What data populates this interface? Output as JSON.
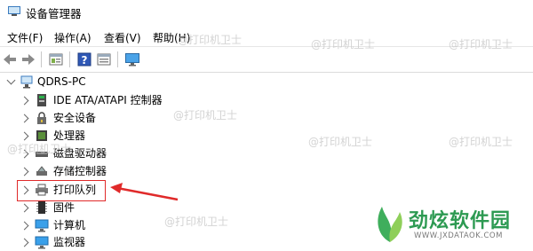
{
  "window": {
    "title": "设备管理器"
  },
  "menu": [
    "文件(F)",
    "操作(A)",
    "查看(V)",
    "帮助(H)"
  ],
  "toolbar": {
    "buttons": [
      "back-icon",
      "forward-icon",
      "properties-icon",
      "help-icon",
      "scan-icon",
      "monitor-icon"
    ]
  },
  "tree": {
    "root": "QDRS-PC",
    "items": [
      {
        "label": "IDE ATA/ATAPI 控制器",
        "icon": "ide-controller-icon"
      },
      {
        "label": "安全设备",
        "icon": "security-device-icon"
      },
      {
        "label": "处理器",
        "icon": "processor-icon"
      },
      {
        "label": "磁盘驱动器",
        "icon": "disk-drive-icon"
      },
      {
        "label": "存储控制器",
        "icon": "storage-controller-icon"
      },
      {
        "label": "打印队列",
        "icon": "printer-icon"
      },
      {
        "label": "固件",
        "icon": "firmware-icon"
      },
      {
        "label": "计算机",
        "icon": "computer-icon"
      },
      {
        "label": "监视器",
        "icon": "monitor-icon"
      }
    ]
  },
  "watermark": {
    "text": "@打印机卫士"
  },
  "logo": {
    "title": "劲炫软件园",
    "url": "WWW.JXDATAOK.COM"
  },
  "colors": {
    "highlight": "#e02a2a",
    "logo_green": "#2d9a52"
  }
}
